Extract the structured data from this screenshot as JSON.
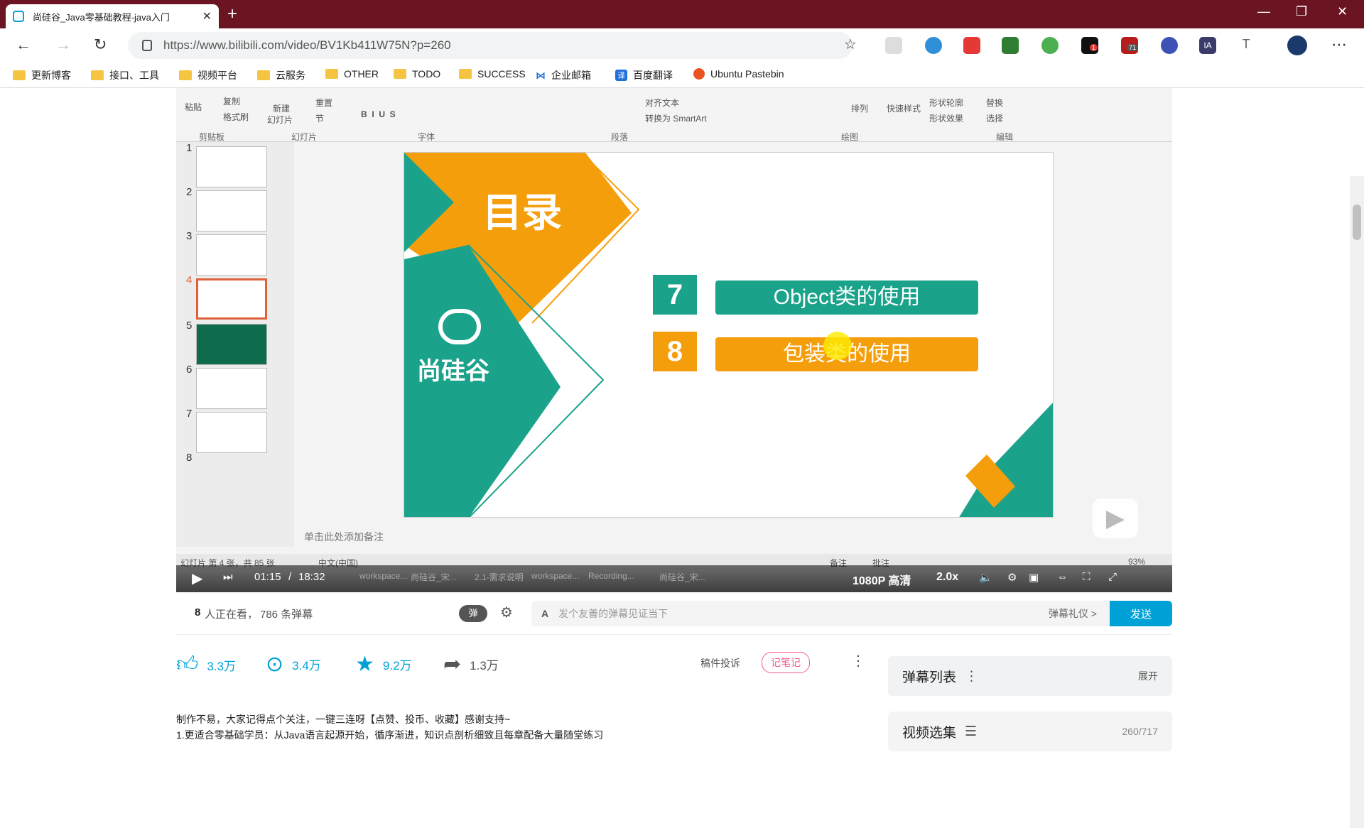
{
  "browser": {
    "tab_title": "尚硅谷_Java零基础教程-java入门",
    "url": "https://www.bilibili.com/video/BV1Kb411W75N?p=260",
    "extension_badges": [
      "1",
      "71"
    ],
    "extension_ia_label": "IA",
    "extension_t_label": "T"
  },
  "bookmarks": [
    "更新博客",
    "接口、工具",
    "视频平台",
    "云服务",
    "OTHER",
    "TODO",
    "SUCCESS",
    "企业邮箱",
    "百度翻译",
    "Ubuntu Pastebin"
  ],
  "ppt": {
    "ribbon": {
      "paste": "粘贴",
      "copy": "复制",
      "format_painter": "格式刷",
      "new_slide": "新建",
      "new_slide2": "幻灯片",
      "reset": "重置",
      "section": "节",
      "groups": [
        "剪贴板",
        "幻灯片",
        "字体",
        "段落",
        "绘图",
        "编辑"
      ],
      "align_text": "对齐文本",
      "convert_smartart": "转换为 SmartArt",
      "arrange": "排列",
      "quick_styles": "快速样式",
      "shape_outline": "形状轮廓",
      "shape_effect": "形状效果",
      "replace": "替换",
      "select": "选择"
    },
    "slide_numbers": [
      "1",
      "2",
      "3",
      "4",
      "5",
      "6",
      "7",
      "8"
    ],
    "selected_slide": 4,
    "slide": {
      "title": "目录",
      "brand": "尚硅谷",
      "items": [
        {
          "num": "7",
          "label": "Object类的使用",
          "color": "#1aa38a"
        },
        {
          "num": "8",
          "label": "包装类的使用",
          "color": "#f59e0b"
        }
      ]
    },
    "notes_placeholder": "单击此处添加备注",
    "status_left": "幻灯片 第 4 张，共 85 张",
    "status_lang": "中文(中国)",
    "status_notes": "备注",
    "status_comments": "批注",
    "zoom": "93%"
  },
  "player": {
    "time_current": "01:15",
    "time_total": "18:32",
    "quality": "1080P 高清",
    "speed": "2.0x",
    "taskbar": [
      "workspace...",
      "尚硅谷_宋...",
      "2.1-需求说明",
      "workspace...",
      "Recording...",
      "尚硅谷_宋..."
    ]
  },
  "info": {
    "watching": "8",
    "watching_text": "人正在看，",
    "danmu_count": "786 条弹幕",
    "danmu_toggle": "弹",
    "danmu_placeholder": "发个友善的弹幕见证当下",
    "danmu_etiquette": "弹幕礼仪 >",
    "send": "发送"
  },
  "actions": {
    "like": "3.3万",
    "coin": "3.4万",
    "fav": "9.2万",
    "share": "1.3万",
    "report": "稿件投诉",
    "note": "记笔记"
  },
  "description": [
    "制作不易，大家记得点个关注，一键三连呀【点赞、投币、收藏】感谢支持~",
    "1.更适合零基础学员：从Java语言起源开始，循序渐进，知识点剖析细致且每章配备大量随堂练习"
  ],
  "sidebar": {
    "danmu_list": "弹幕列表",
    "expand": "展开",
    "video_list": "视频选集",
    "progress": "260/717"
  },
  "colors": {
    "brand": "#00a1d6",
    "titlebar": "#6b1522",
    "teal": "#1aa38a",
    "orange": "#f59e0b"
  }
}
